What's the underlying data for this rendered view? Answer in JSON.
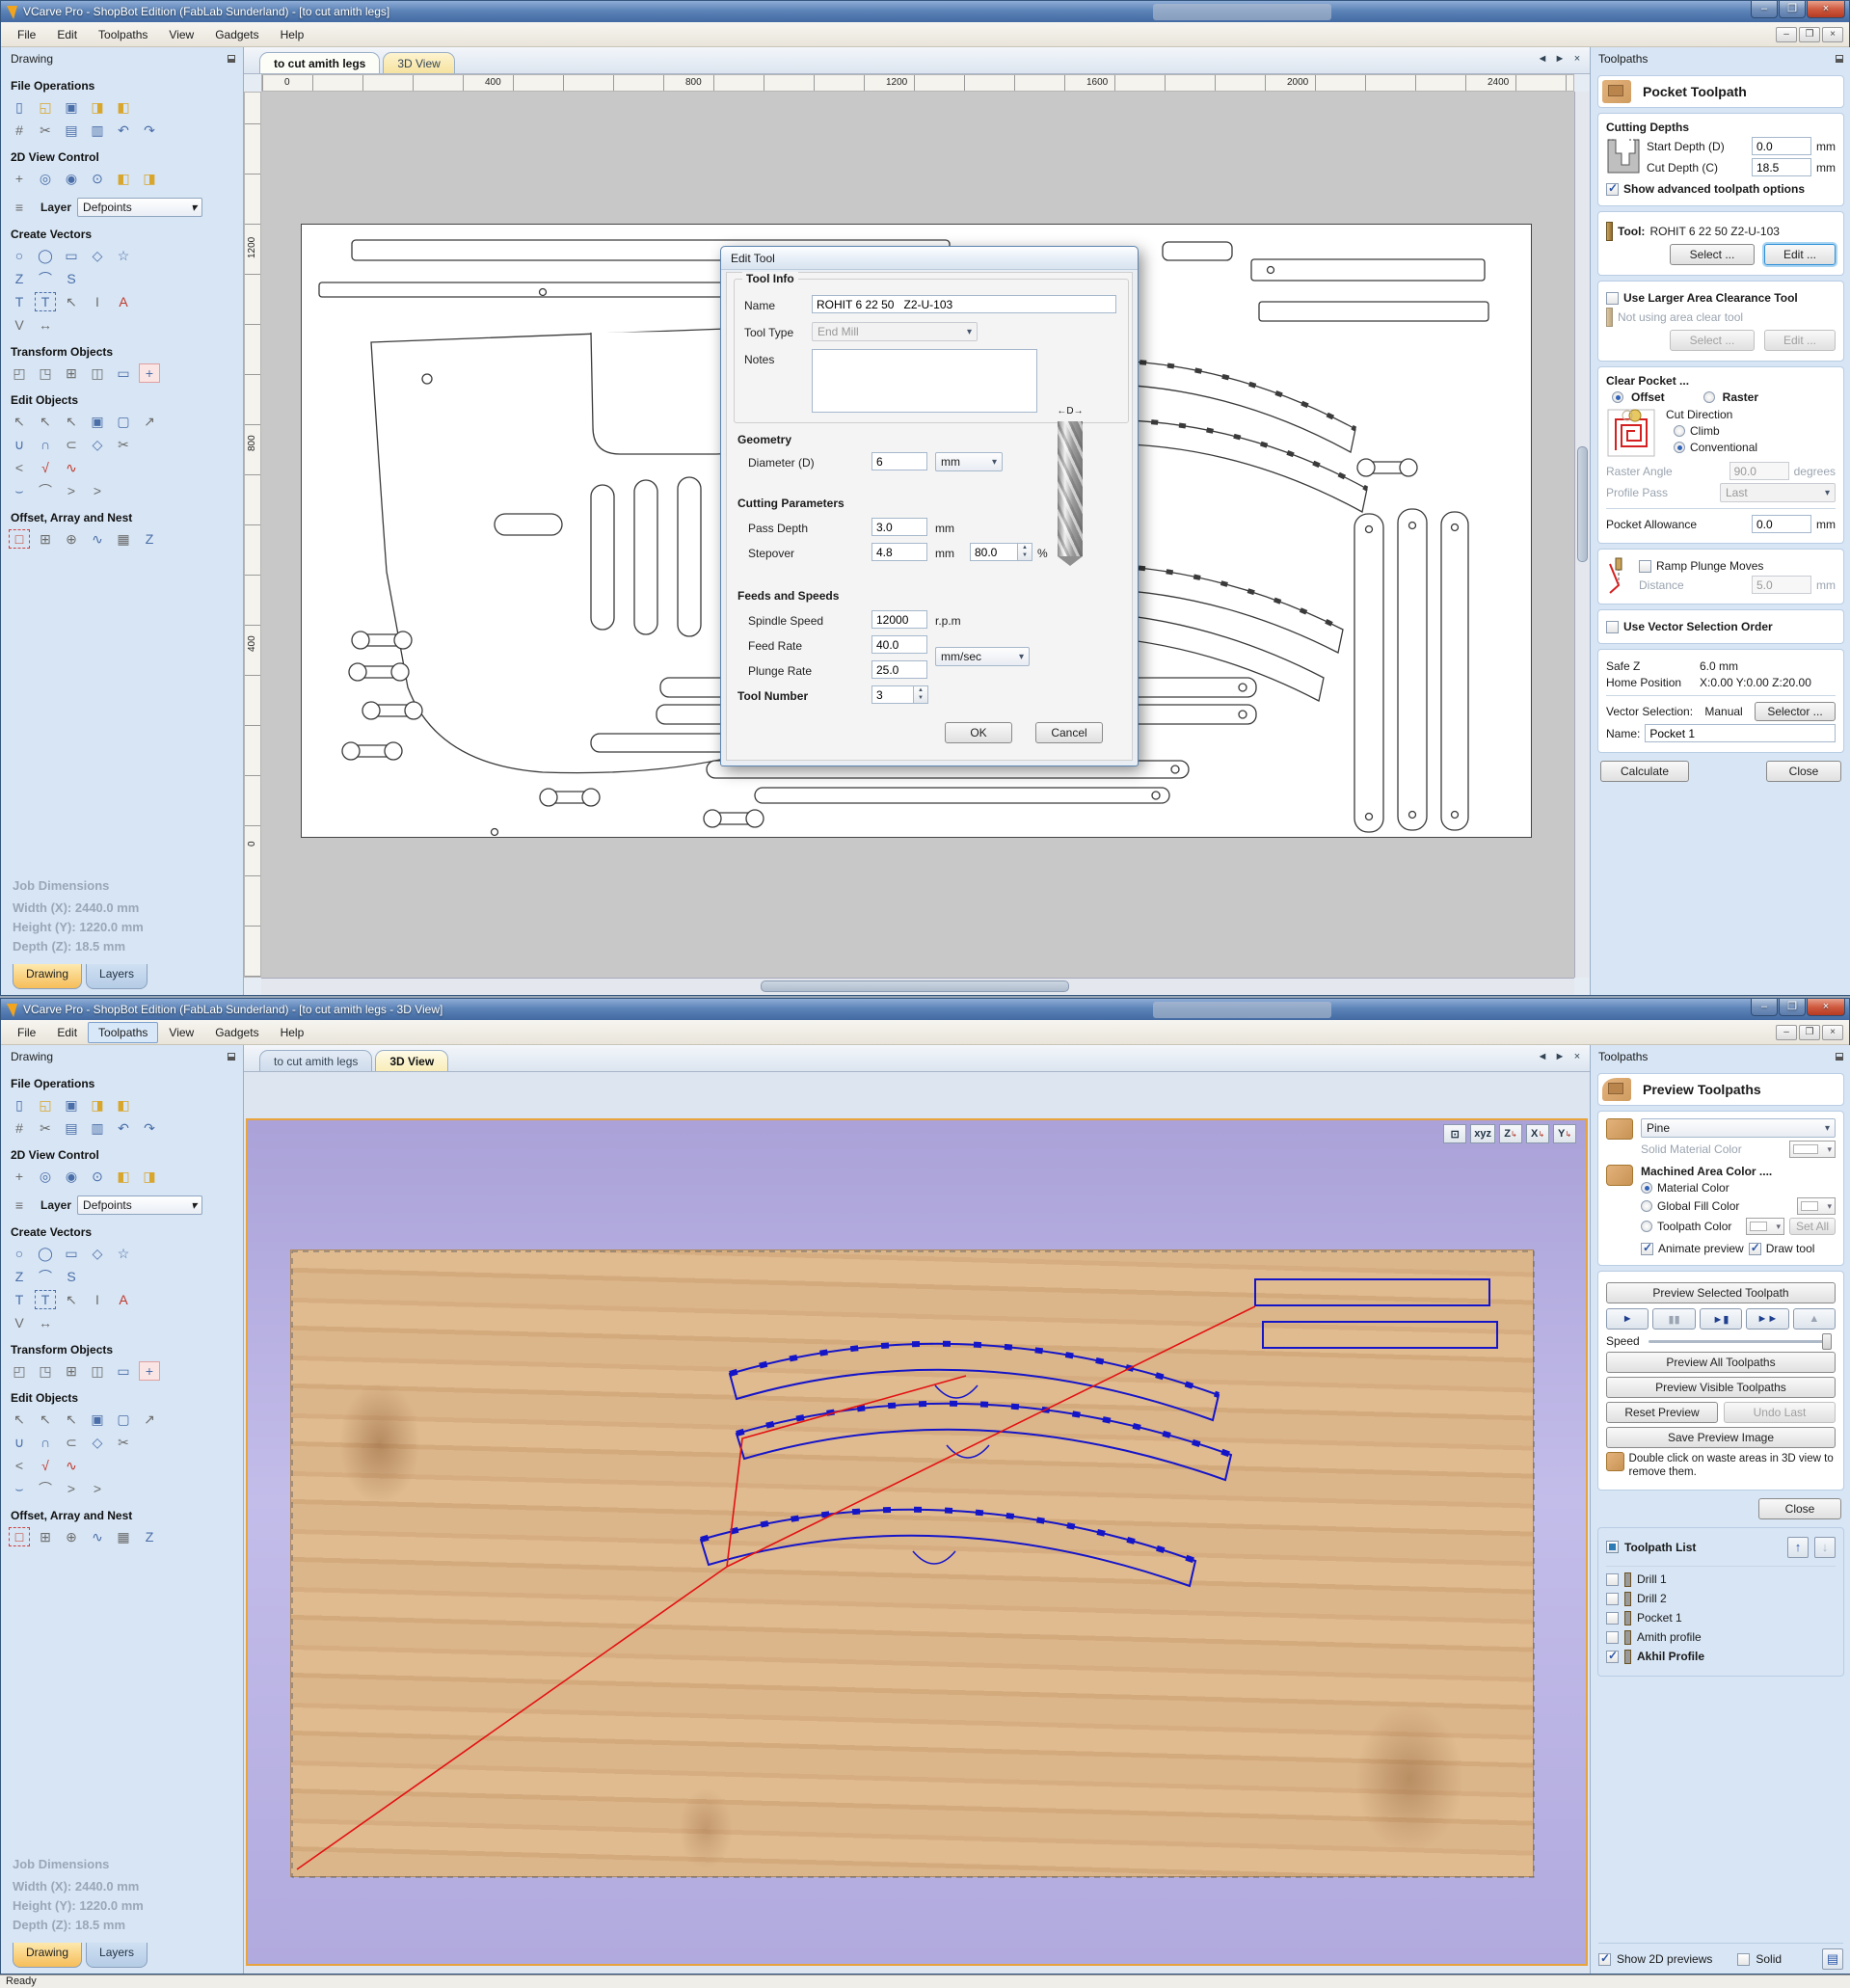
{
  "app": {
    "title_top": "VCarve Pro - ShopBot Edition (FabLab Sunderland) - [to cut amith legs]",
    "title_bottom": "VCarve Pro - ShopBot Edition (FabLab Sunderland) - [to cut amith legs - 3D View]",
    "menu": [
      "File",
      "Edit",
      "Toolpaths",
      "View",
      "Gadgets",
      "Help"
    ],
    "status": "Ready",
    "doc_tab": "to cut amith legs",
    "view3d_tab": "3D View"
  },
  "sidebar": {
    "panel_title": "Drawing",
    "sections": {
      "file_ops": "File Operations",
      "view_control": "2D View Control",
      "create_vectors": "Create Vectors",
      "transform": "Transform Objects",
      "edit_objects": "Edit Objects",
      "offset": "Offset, Array and Nest"
    },
    "layer_label": "Layer",
    "layer_value": "Defpoints",
    "job_dimensions": {
      "title": "Job Dimensions",
      "width": "Width  (X): 2440.0 mm",
      "height": "Height (Y): 1220.0 mm",
      "depth": "Depth  (Z): 18.5 mm"
    },
    "tabs": [
      "Drawing",
      "Layers"
    ]
  },
  "ruler": {
    "h": [
      "0",
      "400",
      "800",
      "1200",
      "1600",
      "2000",
      "2400"
    ],
    "v": [
      "1200",
      "800",
      "400",
      "0"
    ]
  },
  "dialog": {
    "title": "Edit Tool",
    "tool_info": "Tool Info",
    "name_label": "Name",
    "name_value": "ROHIT 6 22 50   Z2-U-103",
    "tool_type_label": "Tool Type",
    "tool_type_value": "End Mill",
    "notes_label": "Notes",
    "geometry": "Geometry",
    "diameter_label": "Diameter (D)",
    "diameter_value": "6",
    "diameter_units": "mm",
    "d_marker": "←D→",
    "cutting_params": "Cutting Parameters",
    "pass_depth_label": "Pass Depth",
    "pass_depth_value": "3.0",
    "stepover_label": "Stepover",
    "stepover_value": "4.8",
    "stepover_pct": "80.0",
    "pct": "%",
    "mm": "mm",
    "feeds": "Feeds and Speeds",
    "spindle_label": "Spindle Speed",
    "spindle_value": "12000",
    "spindle_units": "r.p.m",
    "feed_label": "Feed Rate",
    "feed_value": "40.0",
    "plunge_label": "Plunge Rate",
    "plunge_value": "25.0",
    "rate_units": "mm/sec",
    "tool_number_label": "Tool Number",
    "tool_number_value": "3",
    "ok": "OK",
    "cancel": "Cancel"
  },
  "pocket_panel": {
    "header": "Toolpaths",
    "title": "Pocket Toolpath",
    "cutting_depths": "Cutting Depths",
    "start_depth_label": "Start Depth (D)",
    "start_depth_value": "0.0",
    "cut_depth_label": "Cut Depth (C)",
    "cut_depth_value": "18.5",
    "mm": "mm",
    "show_advanced": "Show advanced toolpath options",
    "tool_label": "Tool:",
    "tool_value": "ROHIT 6 22 50   Z2-U-103",
    "select_btn": "Select ...",
    "edit_btn": "Edit ...",
    "use_larger": "Use Larger Area Clearance Tool",
    "not_using": "Not using area clear tool",
    "clear_pocket": "Clear Pocket ...",
    "offset": "Offset",
    "raster": "Raster",
    "cut_direction": "Cut Direction",
    "climb": "Climb",
    "conventional": "Conventional",
    "raster_angle_label": "Raster Angle",
    "raster_angle_value": "90.0",
    "degrees": "degrees",
    "profile_pass_label": "Profile Pass",
    "profile_pass_value": "Last",
    "pocket_allowance_label": "Pocket Allowance",
    "pocket_allowance_value": "0.0",
    "ramp": "Ramp Plunge Moves",
    "distance_label": "Distance",
    "distance_value": "5.0",
    "use_vector_order": "Use Vector Selection Order",
    "safe_z_label": "Safe Z",
    "safe_z_value": "6.0 mm",
    "home_label": "Home Position",
    "home_value": "X:0.00 Y:0.00 Z:20.00",
    "vector_sel_label": "Vector Selection:",
    "vector_sel_value": "Manual",
    "selector_btn": "Selector ...",
    "name_label": "Name:",
    "name_value": "Pocket 1",
    "calculate": "Calculate",
    "close": "Close"
  },
  "preview_panel": {
    "header": "Toolpaths",
    "title": "Preview Toolpaths",
    "material": "Pine",
    "solid_material_color": "Solid Material Color",
    "machined_area": "Machined Area Color ....",
    "material_color": "Material Color",
    "global_fill": "Global Fill Color",
    "toolpath_color": "Toolpath Color",
    "set_all": "Set All",
    "animate": "Animate preview",
    "draw_tool": "Draw tool",
    "preview_selected": "Preview Selected Toolpath",
    "speed": "Speed",
    "preview_all": "Preview All Toolpaths",
    "preview_visible": "Preview Visible Toolpaths",
    "reset": "Reset Preview",
    "undo_last": "Undo Last",
    "save_image": "Save Preview Image",
    "note": "Double click on waste areas in 3D view to remove them.",
    "close": "Close"
  },
  "toolpath_list": {
    "title": "Toolpath List",
    "items": [
      {
        "label": "Drill 1",
        "checked": false
      },
      {
        "label": "Drill 2",
        "checked": false
      },
      {
        "label": "Pocket 1",
        "checked": false
      },
      {
        "label": "Amith profile",
        "checked": false
      },
      {
        "label": "Akhil Profile",
        "checked": true
      }
    ],
    "show_2d": "Show 2D previews",
    "solid": "Solid"
  },
  "view3d": {
    "fit": "⊡",
    "iso": "xyz",
    "axes": [
      "Z",
      "X",
      "Y"
    ]
  },
  "colors": {
    "titlebar": "#4f76ae",
    "tab_active_orange": "#f6bd59",
    "panel_bg": "#d7e5f4",
    "vector_blue": "#1515c8",
    "toolpath_red": "#e21212",
    "wood": "#d9b287",
    "bg_3d": "#b2abdc",
    "edit_focus_blue": "#2f8fd8"
  },
  "icons": {
    "new_file": "▯",
    "open_file": "◱",
    "save_file": "▣",
    "import_vectors": "◨",
    "export_vectors": "◧",
    "job_setup": "#",
    "cut": "✂",
    "copy": "▤",
    "paste": "▥",
    "undo": "↶",
    "redo": "↷",
    "pan": "+",
    "zoom_interactive": "◎",
    "zoom_box": "◉",
    "zoom_selected": "⊙",
    "zoom_drawing": "◧",
    "zoom_window": "◨",
    "layers": "≡",
    "circle": "○",
    "ellipse": "◯",
    "rectangle": "▭",
    "polygon": "◇",
    "star": "☆",
    "polyline": "Z",
    "arc": "⌒",
    "curve": "S",
    "text": "T",
    "text_box": "T",
    "text_select": "↖",
    "text_frame": "I",
    "text_arc": "A",
    "trace_bitmap": "V",
    "dimension": "↔",
    "move": "◰",
    "set_size": "◳",
    "align": "⊞",
    "mirror": "◫",
    "distort": "▭",
    "snap": "+",
    "select": "↖",
    "node_edit": "↖",
    "interactive_move": "↖",
    "group": "▣",
    "ungroup": "▢",
    "measure": "↗",
    "weld": "∪",
    "subtract": "∩",
    "intersect": "⊂",
    "vector_boolean": "◇",
    "trim": "✂",
    "fillet": "<",
    "validate": "√",
    "fit_curve": "∿",
    "edit_nodes": "⌣",
    "smooth": "⌒",
    "join_open": ">",
    "close_vector": ">",
    "offset_tool": "□",
    "array_copy": "⊞",
    "circular_array": "⊕",
    "copy_along": "∿",
    "nest": "▦",
    "zigzag": "Z",
    "play": "►",
    "pause": "▮▮",
    "step": "►▮",
    "run_all": "►►",
    "stop": "▲",
    "up": "↑",
    "down": "↓",
    "prev": "◄",
    "next": "►",
    "close_x": "×",
    "dropdown": "▾",
    "list": "▤"
  }
}
